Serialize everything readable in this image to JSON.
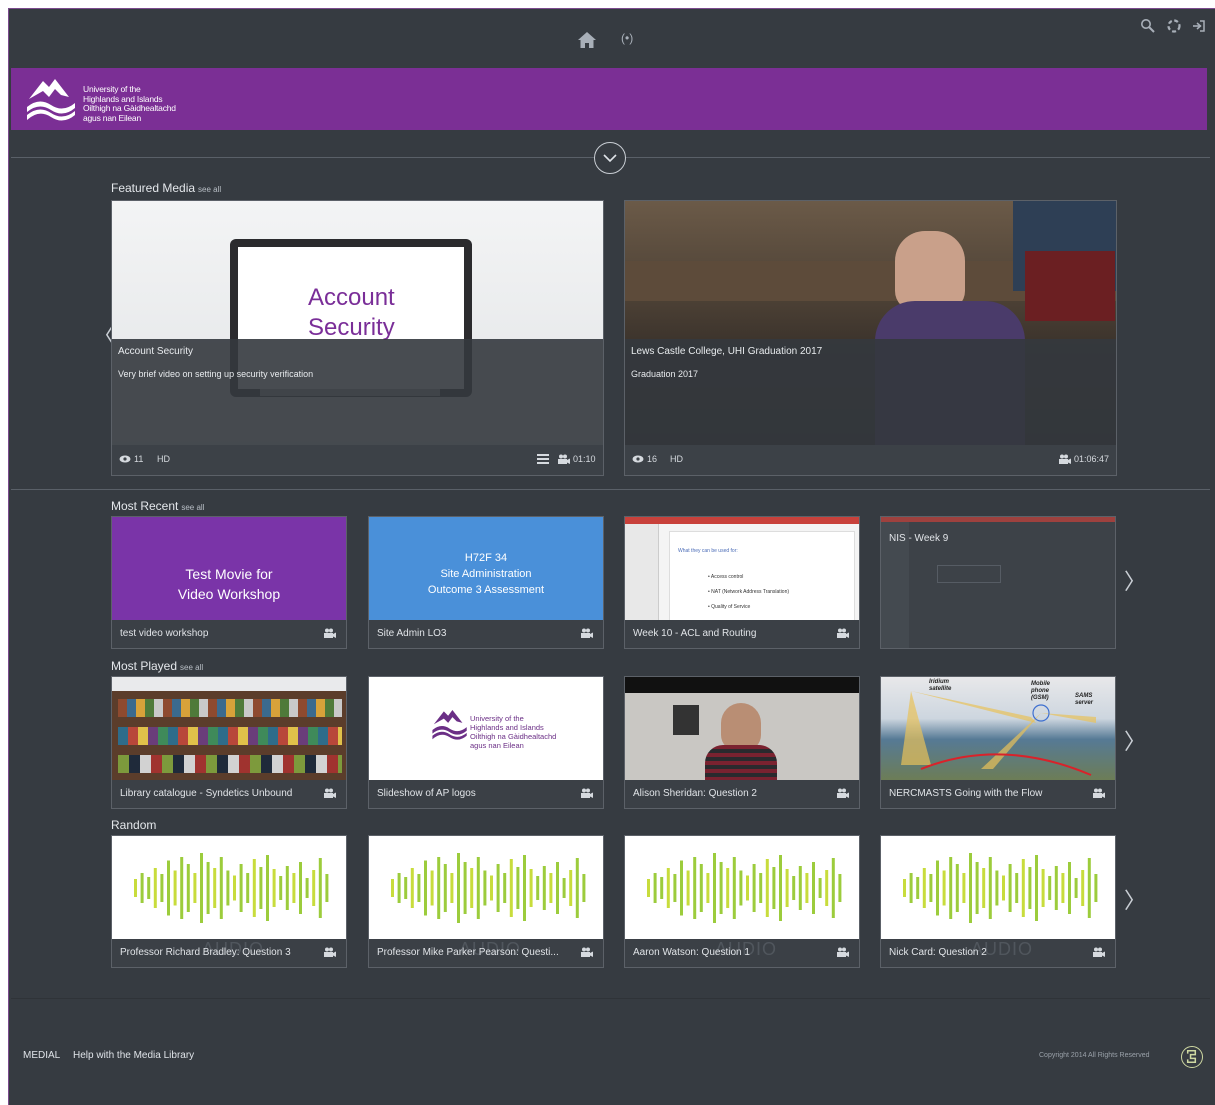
{
  "nav": {
    "live_icon_text": "(•)"
  },
  "banner": {
    "logo_lines": [
      "University of the",
      "Highlands and Islands",
      "Oilthigh na Gàidhealtachd",
      "agus nan Eilean"
    ]
  },
  "featured": {
    "title": "Featured Media",
    "see_all": "see all",
    "items": [
      {
        "thumb_text_line1": "Account",
        "thumb_text_line2": "Security",
        "title": "Account Security",
        "description": "Very brief video on setting up security verification",
        "views": "11",
        "quality": "HD",
        "duration": "01:10"
      },
      {
        "title": "Lews Castle College, UHI Graduation 2017",
        "description": "Graduation 2017",
        "views": "16",
        "quality": "HD",
        "duration": "01:06:47"
      }
    ]
  },
  "most_recent": {
    "title": "Most Recent",
    "see_all": "see all",
    "items": [
      {
        "thumb_line1": "Test Movie for",
        "thumb_line2": "Video Workshop",
        "label": "test video workshop"
      },
      {
        "thumb_line1": "H72F 34",
        "thumb_line2": "Site Administration",
        "thumb_line3": "Outcome 3 Assessment",
        "label": "Site Admin LO3"
      },
      {
        "slide_heading": "What they can be used for:",
        "bullets": [
          "Access control",
          "NAT (Network Address Translation)",
          "Quality of Service"
        ],
        "label": "Week 10 - ACL and Routing"
      },
      {
        "label": "NIS - Week 9"
      }
    ]
  },
  "most_played": {
    "title": "Most Played",
    "see_all": "see all",
    "items": [
      {
        "label": "Library catalogue - Syndetics Unbound"
      },
      {
        "logo_lines": [
          "University of the",
          "Highlands and Islands",
          "Oilthigh na Gàidhealtachd",
          "agus nan Eilean"
        ],
        "label": "Slideshow of AP logos"
      },
      {
        "label": "Alison Sheridan: Question 2"
      },
      {
        "map_labels": [
          "Iridium satellite",
          "Mobile phone (GSM)",
          "SAMS server"
        ],
        "label": "NERCMASTS Going with the Flow"
      }
    ]
  },
  "random": {
    "title": "Random",
    "watermark": "AUDIO",
    "items": [
      {
        "label": "Professor Richard Bradley: Question 3"
      },
      {
        "label": "Professor Mike Parker Pearson: Questi..."
      },
      {
        "label": "Aaron Watson: Question 1"
      },
      {
        "label": "Nick Card: Question 2"
      }
    ]
  },
  "footer": {
    "brand": "MEDIAL",
    "help": "Help with the Media Library",
    "copyright": "Copyright 2014 All Rights Reserved"
  },
  "colors": {
    "background": "#363b41",
    "banner": "#7b2f95",
    "card_purple": "#7a34a8",
    "card_blue": "#4a90d9",
    "waveform_green": "#9ccc3c"
  }
}
